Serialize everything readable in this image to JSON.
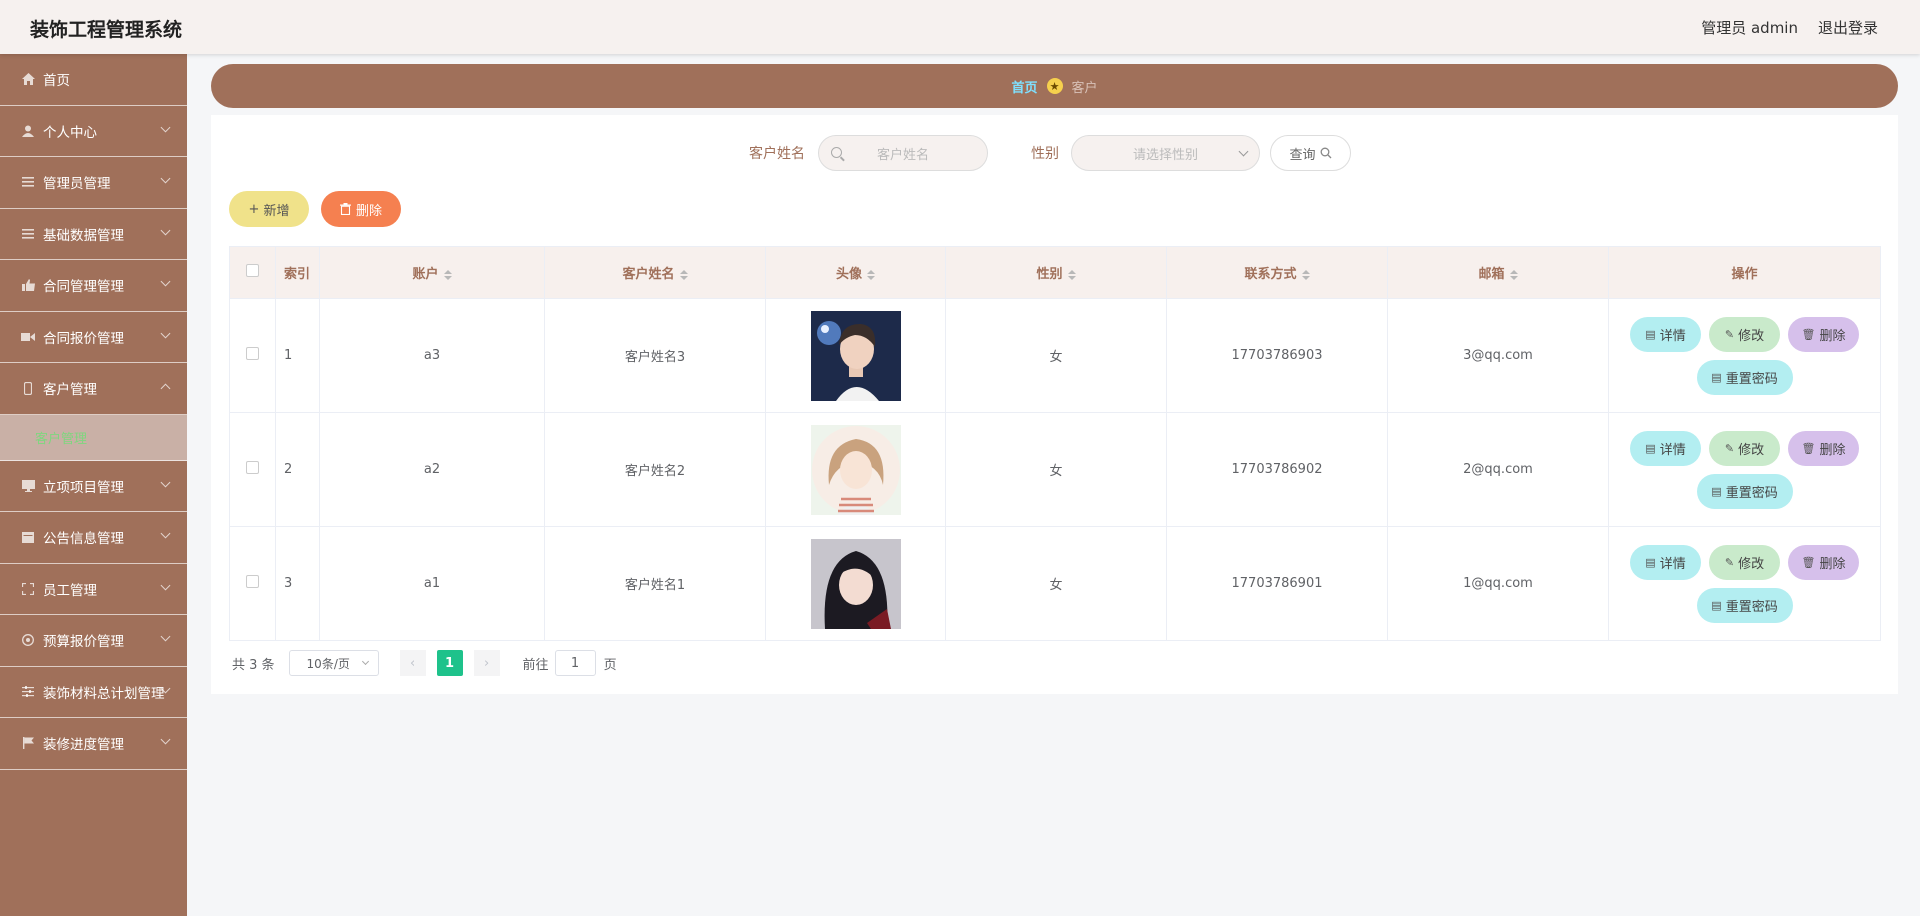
{
  "header": {
    "title": "装饰工程管理系统",
    "user": "管理员 admin",
    "logout": "退出登录"
  },
  "sidebar": {
    "items": [
      {
        "label": "首页",
        "icon": "home-icon"
      },
      {
        "label": "个人中心",
        "icon": "user-icon"
      },
      {
        "label": "管理员管理",
        "icon": "list-icon"
      },
      {
        "label": "基础数据管理",
        "icon": "list-icon"
      },
      {
        "label": "合同管理管理",
        "icon": "thumb-icon"
      },
      {
        "label": "合同报价管理",
        "icon": "video-icon"
      },
      {
        "label": "客户管理",
        "icon": "phone-icon"
      },
      {
        "label": "立项项目管理",
        "icon": "monitor-icon"
      },
      {
        "label": "公告信息管理",
        "icon": "calendar-icon"
      },
      {
        "label": "员工管理",
        "icon": "fullscreen-icon"
      },
      {
        "label": "预算报价管理",
        "icon": "aperture-icon"
      },
      {
        "label": "装饰材料总计划管理",
        "icon": "sliders-icon"
      },
      {
        "label": "装修进度管理",
        "icon": "flag-icon"
      }
    ],
    "subitem": "客户管理"
  },
  "breadcrumb": {
    "home": "首页",
    "current": "客户"
  },
  "search": {
    "name_label": "客户姓名",
    "name_placeholder": "客户姓名",
    "gender_label": "性别",
    "gender_placeholder": "请选择性别",
    "query": "查询"
  },
  "actions": {
    "add": "新增",
    "delete": "删除"
  },
  "table": {
    "headers": {
      "index": "索引",
      "account": "账户",
      "name": "客户姓名",
      "avatar": "头像",
      "gender": "性别",
      "phone": "联系方式",
      "email": "邮箱",
      "ops": "操作"
    },
    "rows": [
      {
        "index": "1",
        "account": "a3",
        "name": "客户姓名3",
        "gender": "女",
        "phone": "17703786903",
        "email": "3@qq.com"
      },
      {
        "index": "2",
        "account": "a2",
        "name": "客户姓名2",
        "gender": "女",
        "phone": "17703786902",
        "email": "2@qq.com"
      },
      {
        "index": "3",
        "account": "a1",
        "name": "客户姓名1",
        "gender": "女",
        "phone": "17703786901",
        "email": "1@qq.com"
      }
    ],
    "op_labels": {
      "detail": "详情",
      "edit": "修改",
      "delete": "删除",
      "reset": "重置密码"
    }
  },
  "pagination": {
    "total": "共 3 条",
    "page_size": "10条/页",
    "current": "1",
    "goto": "前往",
    "goto_value": "1",
    "page_suffix": "页"
  }
}
